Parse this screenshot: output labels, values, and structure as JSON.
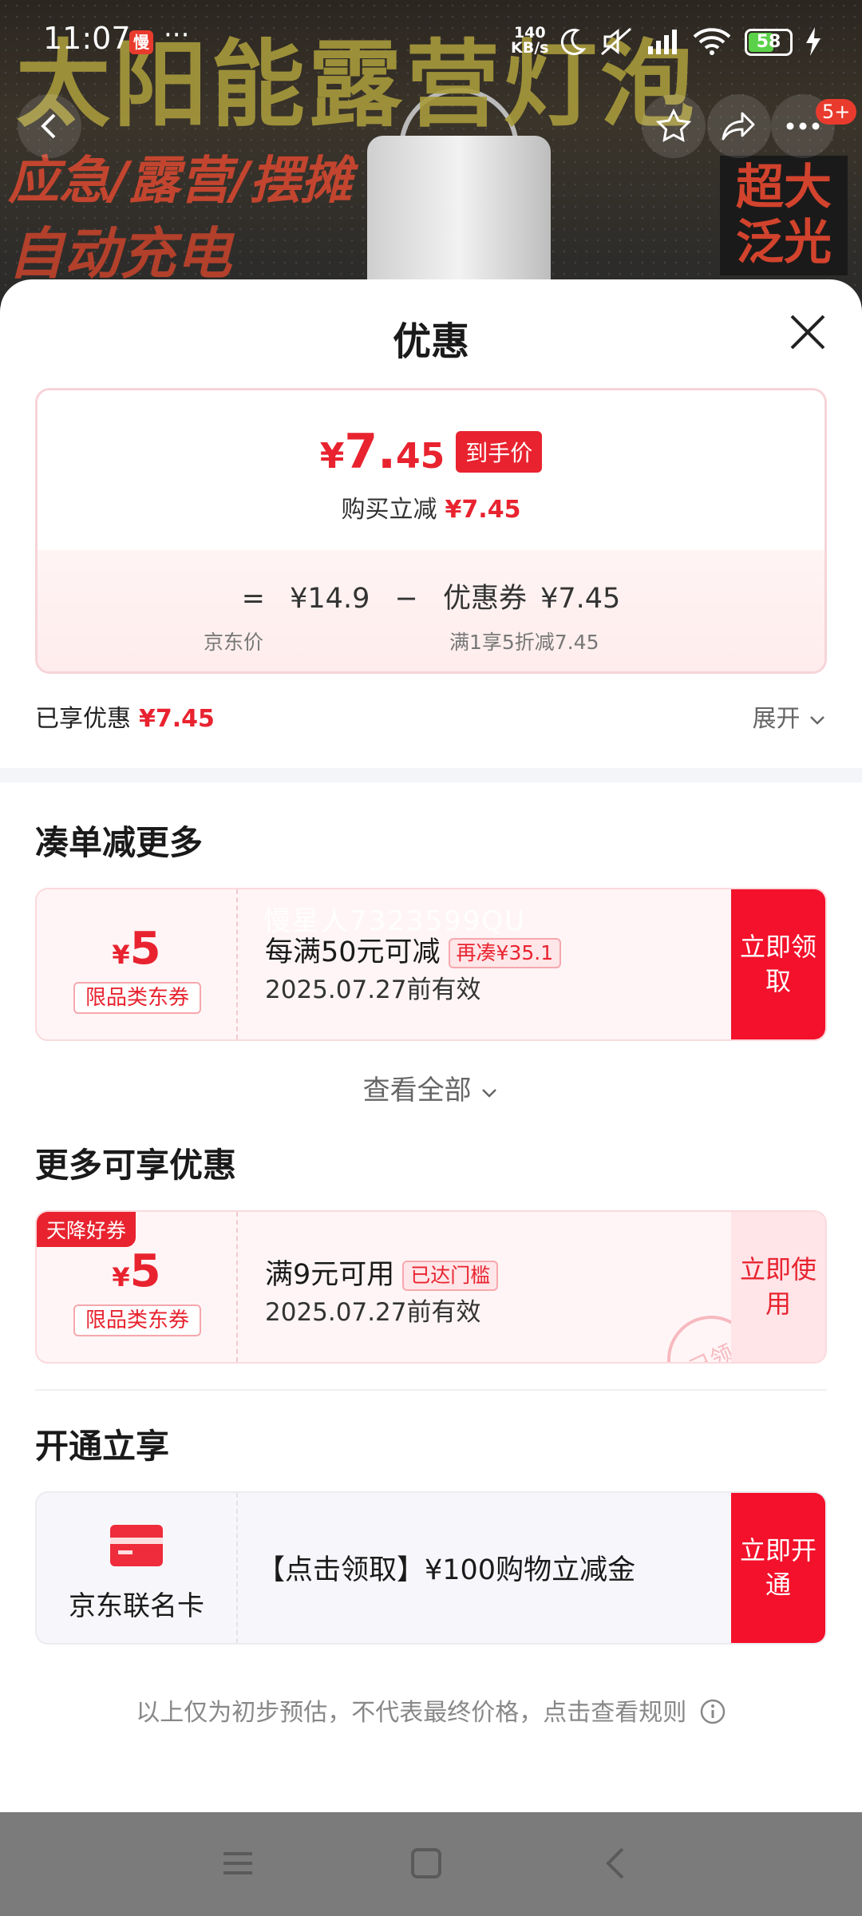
{
  "banner": {
    "title": "太阳能露营灯泡",
    "subtitle1": "应急/露营/摆摊",
    "subtitle2": "自动充电",
    "side_tag": "超大泛光"
  },
  "status_bar": {
    "time": "11:07",
    "app_badge": "慢",
    "net_speed_value": "140",
    "net_speed_unit": "KB/s",
    "battery": "58",
    "battery_level": 0.58
  },
  "top_nav": {
    "cart_count": "5+"
  },
  "sheet": {
    "title": "优惠",
    "price_card": {
      "final_price_yen": "¥",
      "final_price_int": "7.",
      "final_price_dec": "45",
      "final_tag": "到手价",
      "buy_reduce_label": "购买立减",
      "buy_reduce_value": "¥7.45",
      "eq": "=",
      "jd_price": "¥14.9",
      "minus": "−",
      "coupon_label": "优惠券",
      "coupon_value": "¥7.45",
      "jd_price_label": "京东价",
      "coupon_rule": "满1享5折减7.45"
    },
    "enjoyed_label": "已享优惠",
    "enjoyed_value": "¥7.45",
    "expand_label": "展开"
  },
  "section_more": {
    "title": "凑单减更多",
    "coupon": {
      "yen": "¥",
      "amount": "5",
      "scope": "限品类东券",
      "watermark": "慢星人7323599QU",
      "condition": "每满50元可减",
      "pill": "再凑¥35.1",
      "valid": "2025.07.27前有效",
      "action": "立即领取"
    },
    "view_all": "查看全部"
  },
  "section_enjoy": {
    "title": "更多可享优惠",
    "coupon": {
      "tag": "天降好券",
      "yen": "¥",
      "amount": "5",
      "scope": "限品类东券",
      "condition": "满9元可用",
      "pill": "已达门槛",
      "valid": "2025.07.27前有效",
      "stamp": "已领",
      "action": "立即使用"
    }
  },
  "section_open": {
    "title": "开通立享",
    "card_name": "京东联名卡",
    "desc": "【点击领取】¥100购物立减金",
    "action": "立即开通"
  },
  "disclaimer": "以上仅为初步预估，不代表最终价格，点击查看规则",
  "colors": {
    "accent": "#e8232f",
    "action_red": "#f3112b"
  }
}
